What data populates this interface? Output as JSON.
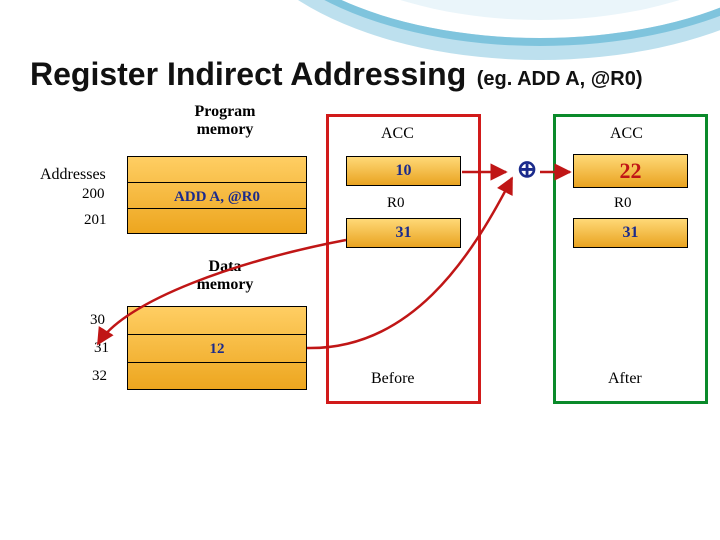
{
  "title": {
    "main": "Register Indirect Addressing",
    "example": "(eg. ADD A, @R0)"
  },
  "program_memory": {
    "heading": "Program\nmemory",
    "addresses_label": "Addresses",
    "rows": [
      {
        "addr": "200",
        "instr": "ADD  A, @R0"
      },
      {
        "addr": "201",
        "instr": ""
      }
    ]
  },
  "data_memory": {
    "heading": "Data\nmemory",
    "rows": [
      {
        "addr": "30",
        "val": ""
      },
      {
        "addr": "31",
        "val": "12"
      },
      {
        "addr": "32",
        "val": ""
      }
    ]
  },
  "before": {
    "frame_color": "#d11a1a",
    "heading": "ACC",
    "acc_value": "10",
    "reg_label": "R0",
    "reg_value": "31",
    "footer": "Before"
  },
  "after": {
    "frame_color": "#0a8a2a",
    "heading": "ACC",
    "acc_value": "22",
    "reg_label": "R0",
    "reg_value": "31",
    "footer": "After"
  },
  "plus_symbol": "⊕"
}
